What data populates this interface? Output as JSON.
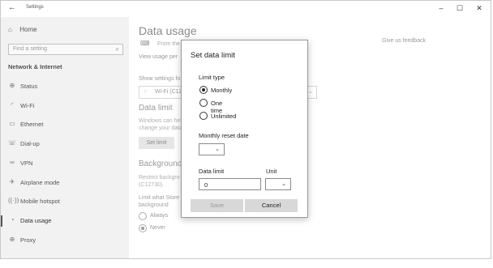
{
  "window": {
    "title": "Settings",
    "back_glyph": "←",
    "minimize_glyph": "–",
    "maximize_glyph": "☐",
    "close_glyph": "✕"
  },
  "sidebar": {
    "home_label": "Home",
    "home_icon": "⌂",
    "search_placeholder": "Find a setting",
    "search_icon": "⌕",
    "section_heading": "Network & Internet",
    "items": [
      {
        "label": "Status",
        "icon": "⊕"
      },
      {
        "label": "Wi-Fi",
        "icon": "◜"
      },
      {
        "label": "Ethernet",
        "icon": "▭"
      },
      {
        "label": "Dial-up",
        "icon": "☏"
      },
      {
        "label": "VPN",
        "icon": "∞"
      },
      {
        "label": "Airplane mode",
        "icon": "✈"
      },
      {
        "label": "Mobile hotspot",
        "icon": "((·))"
      },
      {
        "label": "Data usage",
        "icon": "◔"
      },
      {
        "label": "Proxy",
        "icon": "⊕"
      }
    ],
    "active_index": 7
  },
  "main": {
    "page_title": "Data usage",
    "feedback_link": "Give us feedback",
    "net_icon": "⌨",
    "from_text": "From the",
    "view_usage": "View usage per",
    "show_settings": "Show settings fo",
    "wifi_select_icon": "◜",
    "wifi_select_value": "Wi-Fi (C12",
    "wifi_select_chevron": "⌄",
    "data_limit_title": "Data limit",
    "data_limit_desc_1": "Windows can hel",
    "data_limit_desc_2": "change your data",
    "set_limit_button": "Set limit",
    "background_title": "Background",
    "background_desc_1": "Restrict backgro",
    "background_desc_2": "(C12730).",
    "limit_what_1": "Limit what Store",
    "limit_what_2": "background",
    "radio_always": "Always",
    "radio_never": "Never"
  },
  "dialog": {
    "title": "Set data limit",
    "limit_type_label": "Limit type",
    "options": [
      "Monthly",
      "One time",
      "Unlimited"
    ],
    "selected_option": "Monthly",
    "monthly_reset_label": "Monthly reset date",
    "reset_date_value": "",
    "select_chevron": "⌄",
    "data_limit_label": "Data limit",
    "data_limit_value": "0",
    "unit_label": "Unit",
    "unit_value": "",
    "save_button": "Save",
    "cancel_button": "Cancel"
  },
  "colors": {
    "sidebar_bg": "#f2f2f2",
    "dialog_border": "#9a9a9a",
    "button_bg": "#d8d8d8",
    "disabled_text": "#9a9a9a"
  }
}
